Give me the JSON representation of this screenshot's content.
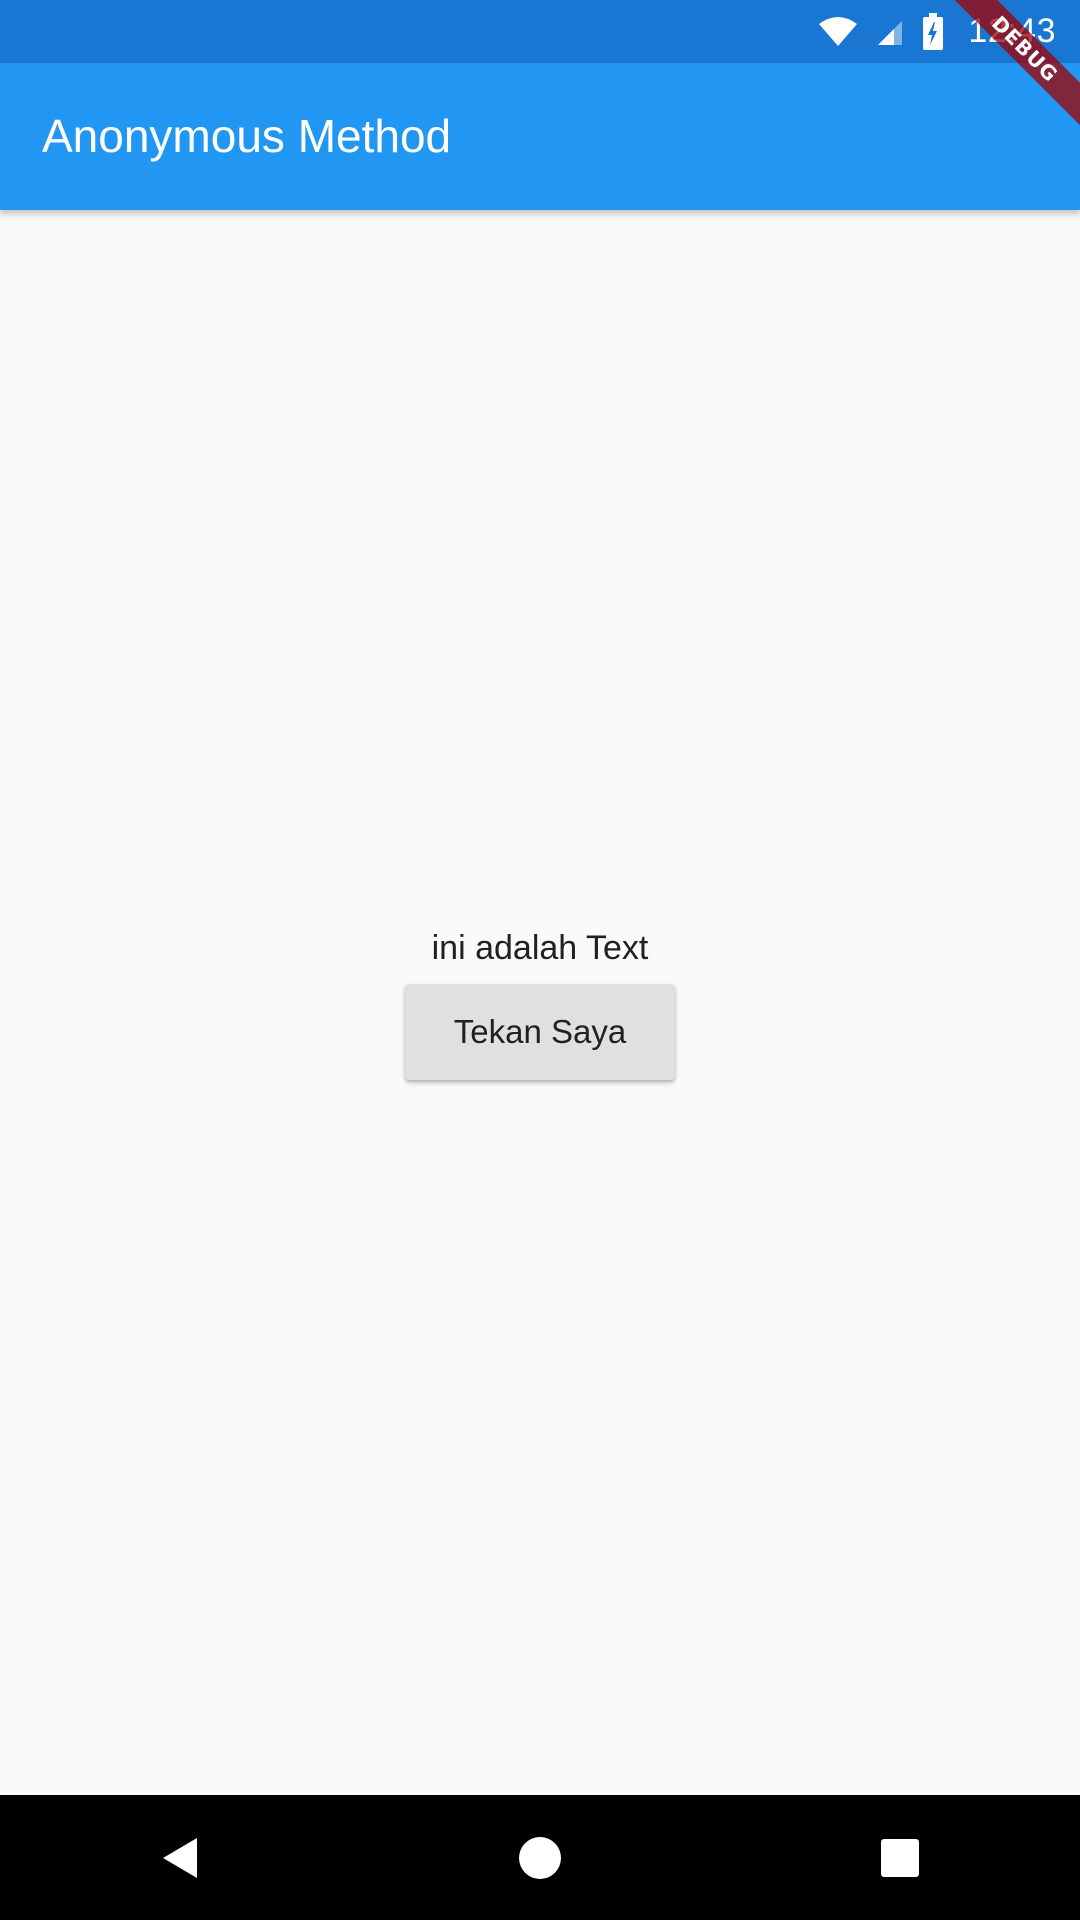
{
  "status_bar": {
    "time": "12:43",
    "icons": [
      "wifi-icon",
      "cell-signal-icon",
      "battery-charging-icon"
    ]
  },
  "debug_banner": {
    "label": "DEBUG"
  },
  "app_bar": {
    "title": "Anonymous Method"
  },
  "body": {
    "text": "ini adalah Text",
    "button_label": "Tekan Saya"
  },
  "nav_bar": {
    "buttons": [
      "back-icon",
      "home-icon",
      "recents-icon"
    ]
  },
  "colors": {
    "status_bar": "#1976d2",
    "app_bar": "#2196f3",
    "background": "#fafafa",
    "button": "#e0e0e0",
    "nav_bar": "#000000"
  }
}
